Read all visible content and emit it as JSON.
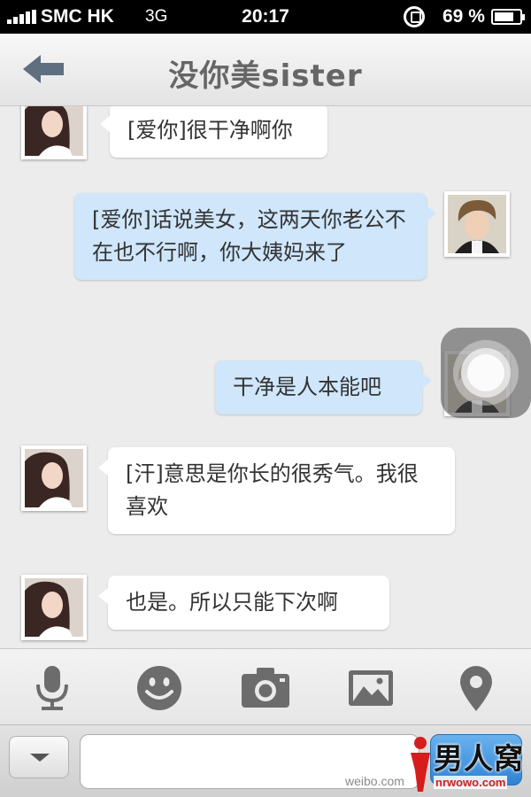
{
  "status_bar": {
    "carrier": "SMC HK",
    "network": "3G",
    "time": "20:17",
    "battery_percent": "69 %",
    "battery_level": 0.69
  },
  "nav": {
    "title": "没你美sister",
    "back_icon": "back-arrow-icon"
  },
  "messages": [
    {
      "side": "in",
      "text": "[爱你]很干净啊你"
    },
    {
      "side": "out",
      "text": "[爱你]话说美女，这两天你老公不在也不行啊，你大姨妈来了"
    },
    {
      "side": "out",
      "text": "干净是人本能吧"
    },
    {
      "side": "in",
      "text": "[汗]意思是你长的很秀气。我很喜欢"
    },
    {
      "side": "in",
      "text": "也是。所以只能下次啊"
    }
  ],
  "toolbar": {
    "icons": [
      "microphone-icon",
      "emoji-icon",
      "camera-icon",
      "image-icon",
      "location-icon"
    ]
  },
  "input": {
    "value": "",
    "placeholder": ""
  },
  "watermark": {
    "title": "男人窝",
    "domain": "nrwowo.com",
    "weibo": "weibo.com"
  },
  "colors": {
    "incoming_bubble": "#ffffff",
    "outgoing_bubble": "#cfe6fb",
    "send_button": "#3b8fdd",
    "watermark_red": "#d51d1d"
  }
}
